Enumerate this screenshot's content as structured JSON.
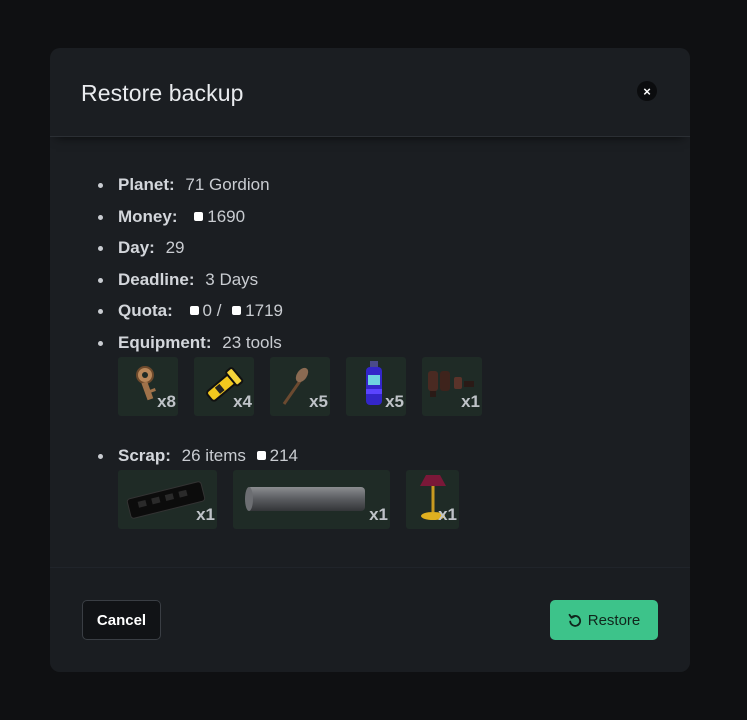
{
  "modal": {
    "title": "Restore backup",
    "close_icon": "×"
  },
  "info": {
    "planet": {
      "label": "Planet:",
      "value": "71 Gordion"
    },
    "money": {
      "label": "Money:",
      "value": "1690"
    },
    "day": {
      "label": "Day:",
      "value": "29"
    },
    "deadline": {
      "label": "Deadline:",
      "value": "3 Days"
    },
    "quota": {
      "label": "Quota:",
      "current": "0 /",
      "target": "1719"
    },
    "equipment": {
      "label": "Equipment:",
      "value": "23 tools",
      "items": [
        {
          "icon": "key-icon",
          "count": "x8"
        },
        {
          "icon": "flashlight-icon",
          "count": "x4"
        },
        {
          "icon": "shovel-icon",
          "count": "x5"
        },
        {
          "icon": "spray-bottle-icon",
          "count": "x5"
        },
        {
          "icon": "jetpack-icon",
          "count": "x1"
        }
      ]
    },
    "scrap": {
      "label": "Scrap:",
      "value": "26 items",
      "total": "214",
      "items": [
        {
          "icon": "power-strip-icon",
          "count": "x1"
        },
        {
          "icon": "pipe-icon",
          "count": "x1"
        },
        {
          "icon": "lamp-icon",
          "count": "x1"
        }
      ]
    }
  },
  "footer": {
    "cancel_label": "Cancel",
    "restore_label": "Restore",
    "restore_icon": "undo-icon"
  },
  "colors": {
    "accent": "#3dc38a",
    "background": "#0f1012",
    "modal": "#1b1e22",
    "item_card": "#1f2b26"
  }
}
